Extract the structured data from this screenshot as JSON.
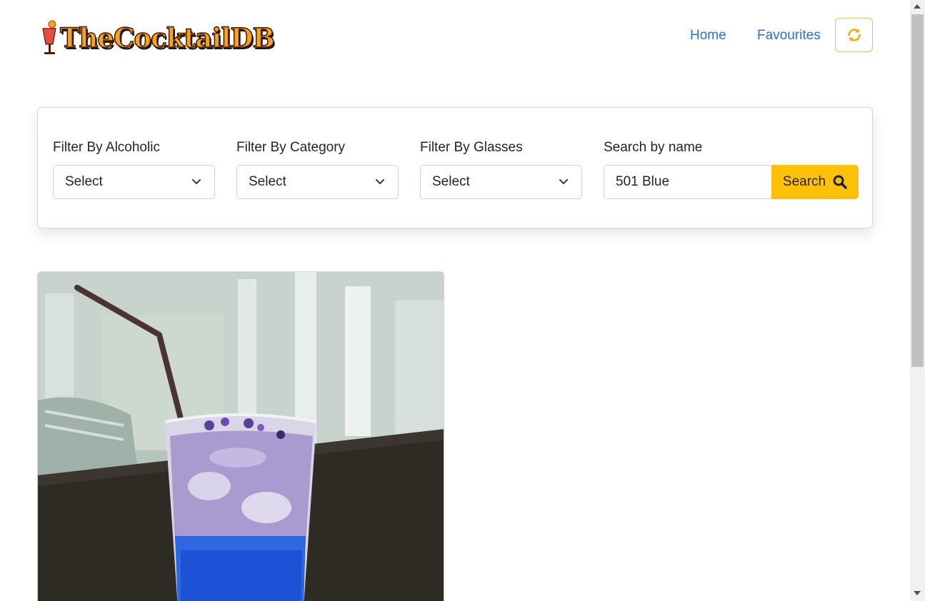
{
  "header": {
    "logo_text": "TheCocktailDB",
    "nav": [
      {
        "label": "Home"
      },
      {
        "label": "Favourites"
      }
    ],
    "refresh_icon": "refresh-icon"
  },
  "filters": {
    "alcoholic": {
      "label": "Filter By Alcoholic",
      "value": "Select"
    },
    "category": {
      "label": "Filter By Category",
      "value": "Select"
    },
    "glasses": {
      "label": "Filter By Glasses",
      "value": "Select"
    },
    "search": {
      "label": "Search by name",
      "value": "501 Blue",
      "button_label": "Search",
      "button_icon": "search-icon"
    }
  },
  "colors": {
    "accent": "#ffc107",
    "link": "#2a6edc",
    "logo_fill": "#f7a21b"
  },
  "results": [
    {
      "image": "blue-cocktail-glass-with-straw"
    }
  ]
}
